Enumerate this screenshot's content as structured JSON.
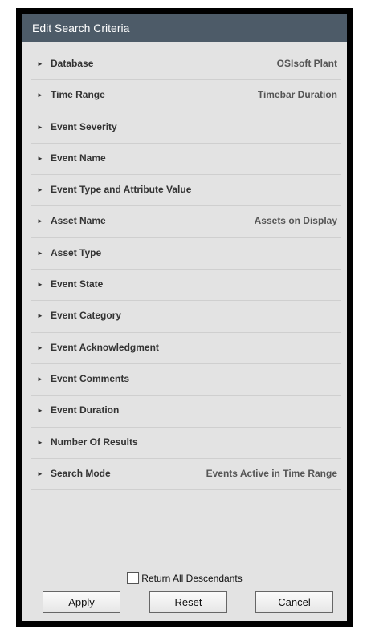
{
  "dialog": {
    "title": "Edit Search Criteria"
  },
  "criteria": [
    {
      "label": "Database",
      "value": "OSIsoft Plant"
    },
    {
      "label": "Time Range",
      "value": "Timebar Duration"
    },
    {
      "label": "Event Severity",
      "value": ""
    },
    {
      "label": "Event Name",
      "value": ""
    },
    {
      "label": "Event Type and Attribute Value",
      "value": ""
    },
    {
      "label": "Asset Name",
      "value": "Assets on Display"
    },
    {
      "label": "Asset Type",
      "value": ""
    },
    {
      "label": "Event State",
      "value": ""
    },
    {
      "label": "Event Category",
      "value": ""
    },
    {
      "label": "Event Acknowledgment",
      "value": ""
    },
    {
      "label": "Event Comments",
      "value": ""
    },
    {
      "label": "Event Duration",
      "value": ""
    },
    {
      "label": "Number Of Results",
      "value": ""
    },
    {
      "label": "Search Mode",
      "value": "Events Active in Time Range"
    }
  ],
  "expand_glyph": "►",
  "return_all_descendants": {
    "label": "Return All Descendants",
    "checked": false
  },
  "buttons": {
    "apply": "Apply",
    "reset": "Reset",
    "cancel": "Cancel"
  },
  "colors": {
    "titlebar": "#4d5b68",
    "panel": "#e3e3e3",
    "frame": "#000000"
  }
}
